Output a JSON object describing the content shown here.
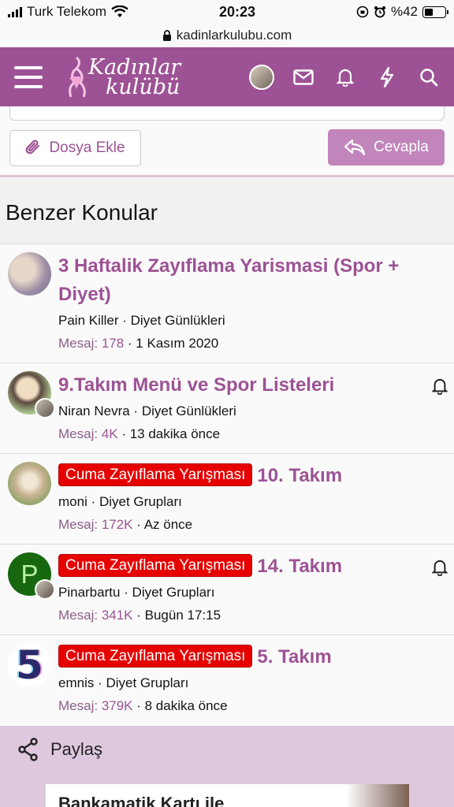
{
  "status_bar": {
    "carrier": "Turk Telekom",
    "time": "20:23",
    "battery": "%42",
    "battery_level": 0.42
  },
  "browser": {
    "url": "kadinlarkulubu.com"
  },
  "header": {
    "logo_line1": "Kadınlar",
    "logo_line2": "kulübü",
    "accent": "#9d5295"
  },
  "reply": {
    "attach_label": "Dosya Ekle",
    "reply_label": "Cevapla"
  },
  "similar": {
    "heading": "Benzer Konular",
    "threads": [
      {
        "prefix": "",
        "title": "3 Haftalik Zayıflama Yarismasi (Spor + Diyet)",
        "author": "Pain Killer",
        "forum": "Diyet Günlükleri",
        "replies_label": "Mesaj:",
        "replies": "178",
        "date": "1 Kasım 2020",
        "watched": false
      },
      {
        "prefix": "",
        "title": "9.Takım Menü ve Spor Listeleri",
        "author": "Niran Nevra",
        "forum": "Diyet Günlükleri",
        "replies_label": "Mesaj:",
        "replies": "4K",
        "date": "13 dakika önce",
        "watched": true
      },
      {
        "prefix": "Cuma Zayıflama Yarışması",
        "title": "10. Takım",
        "author": "moni",
        "forum": "Diyet Grupları",
        "replies_label": "Mesaj:",
        "replies": "172K",
        "date": "Az önce",
        "watched": false
      },
      {
        "prefix": "Cuma Zayıflama Yarışması",
        "title": "14. Takım",
        "author": "Pinarbartu",
        "forum": "Diyet Grupları",
        "replies_label": "Mesaj:",
        "replies": "341K",
        "date": "Bugün 17:15",
        "watched": true,
        "avatar_letter": "P"
      },
      {
        "prefix": "Cuma Zayıflama Yarışması",
        "title": "5. Takım",
        "author": "emnis",
        "forum": "Diyet Grupları",
        "replies_label": "Mesaj:",
        "replies": "379K",
        "date": "8 dakika önce",
        "watched": false,
        "avatar_letter": "5"
      }
    ]
  },
  "share": {
    "label": "Paylaş"
  },
  "ad": {
    "text": "Bankamatik Kartı ile"
  }
}
